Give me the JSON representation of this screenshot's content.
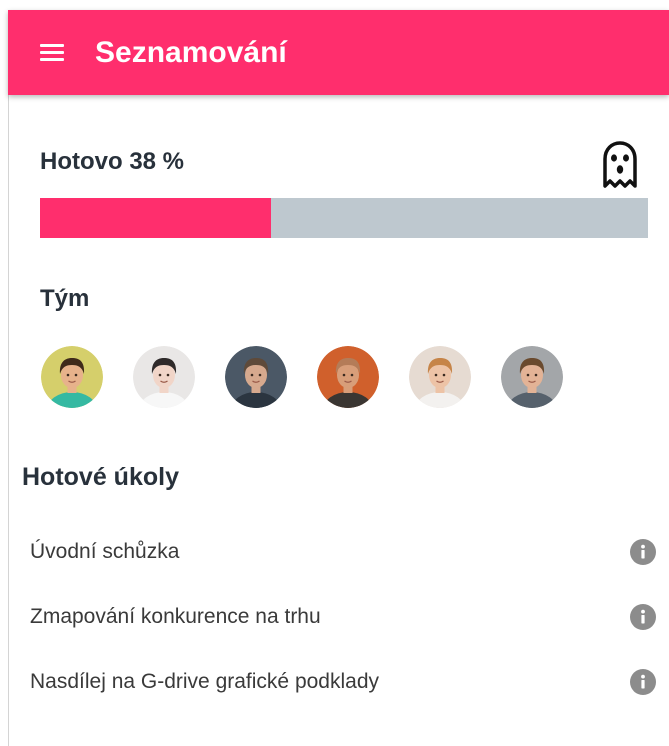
{
  "header": {
    "title": "Seznamování",
    "menu_icon": "menu-icon"
  },
  "progress": {
    "label": "Hotovo 38 %",
    "value": 0.38,
    "status_icon": "ghost-icon"
  },
  "team": {
    "title": "Tým",
    "members": [
      {
        "bg": "#D5CF6B",
        "skin": "#E7B28B",
        "hair": "#3F2A1A",
        "shirt": "#35B9A2"
      },
      {
        "bg": "#E9E7E6",
        "skin": "#F1D5C8",
        "hair": "#2F2A2A",
        "shirt": "#F7F7F7"
      },
      {
        "bg": "#4B5866",
        "skin": "#D6A98E",
        "hair": "#5E4A3A",
        "shirt": "#2B3540"
      },
      {
        "bg": "#D0602C",
        "skin": "#D89E79",
        "hair": "#B47C58",
        "shirt": "#3A3632"
      },
      {
        "bg": "#E6DBD2",
        "skin": "#EDC3A6",
        "hair": "#C68448",
        "shirt": "#F3F1EF"
      },
      {
        "bg": "#A3A6A9",
        "skin": "#E3B396",
        "hair": "#6A4A2E",
        "shirt": "#56616C"
      }
    ]
  },
  "done_tasks": {
    "title": "Hotové úkoly",
    "items": [
      {
        "label": "Úvodní schůzka",
        "icon": "info-icon"
      },
      {
        "label": "Zmapování konkurence na trhu",
        "icon": "info-icon"
      },
      {
        "label": "Nasdílej na G-drive grafické podklady",
        "icon": "info-icon"
      }
    ]
  },
  "colors": {
    "accent": "#FF2E6D",
    "progress_track": "#BEC8CF",
    "heading_text": "#28313B",
    "body_text": "#3A3A3A",
    "info_icon": "#8C8C8C"
  }
}
